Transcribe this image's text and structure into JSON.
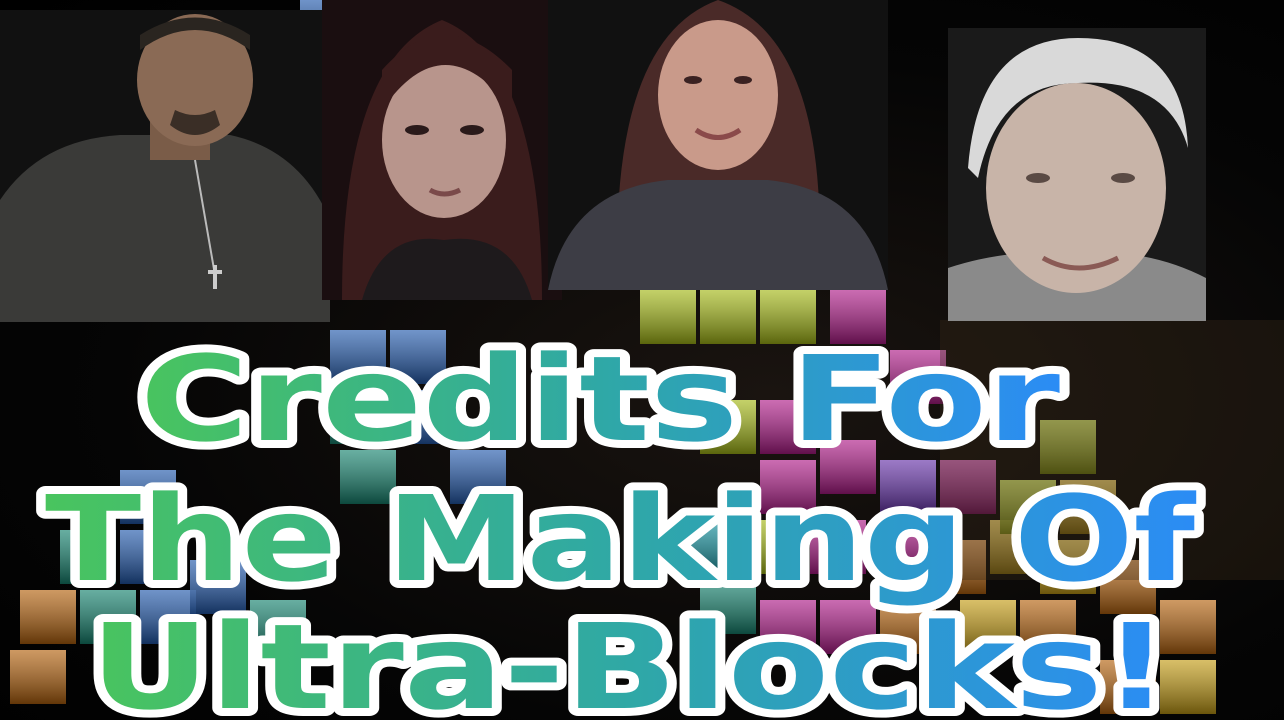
{
  "title": {
    "lines": [
      "Credits For",
      "The Making Of",
      "Ultra-Blocks!"
    ],
    "gradient_start": "#49c45e",
    "gradient_mid": "#2fa8a6",
    "gradient_end": "#2b8cf5",
    "outline": "#ffffff"
  },
  "people": [
    {
      "id": "man",
      "skin": "#8a6a55",
      "hair": "#2a2520",
      "shirt": "#3a3a38"
    },
    {
      "id": "young-woman",
      "skin": "#b8958c",
      "hair": "#3a1c1c",
      "shirt": "#1e1a1c"
    },
    {
      "id": "woman",
      "skin": "#c99a8a",
      "hair": "#4a2a28",
      "shirt": "#3d3d45"
    },
    {
      "id": "elder",
      "skin": "#c8b4a8",
      "hair": "#d9d9d9",
      "shirt": "#8a8a8a"
    }
  ],
  "block_colors": [
    "#2b6fd6",
    "#1aa38a",
    "#c8e21a",
    "#d61fa8",
    "#e07a12",
    "#f2c21a",
    "#7a3bd0",
    "#1cb8c8"
  ]
}
